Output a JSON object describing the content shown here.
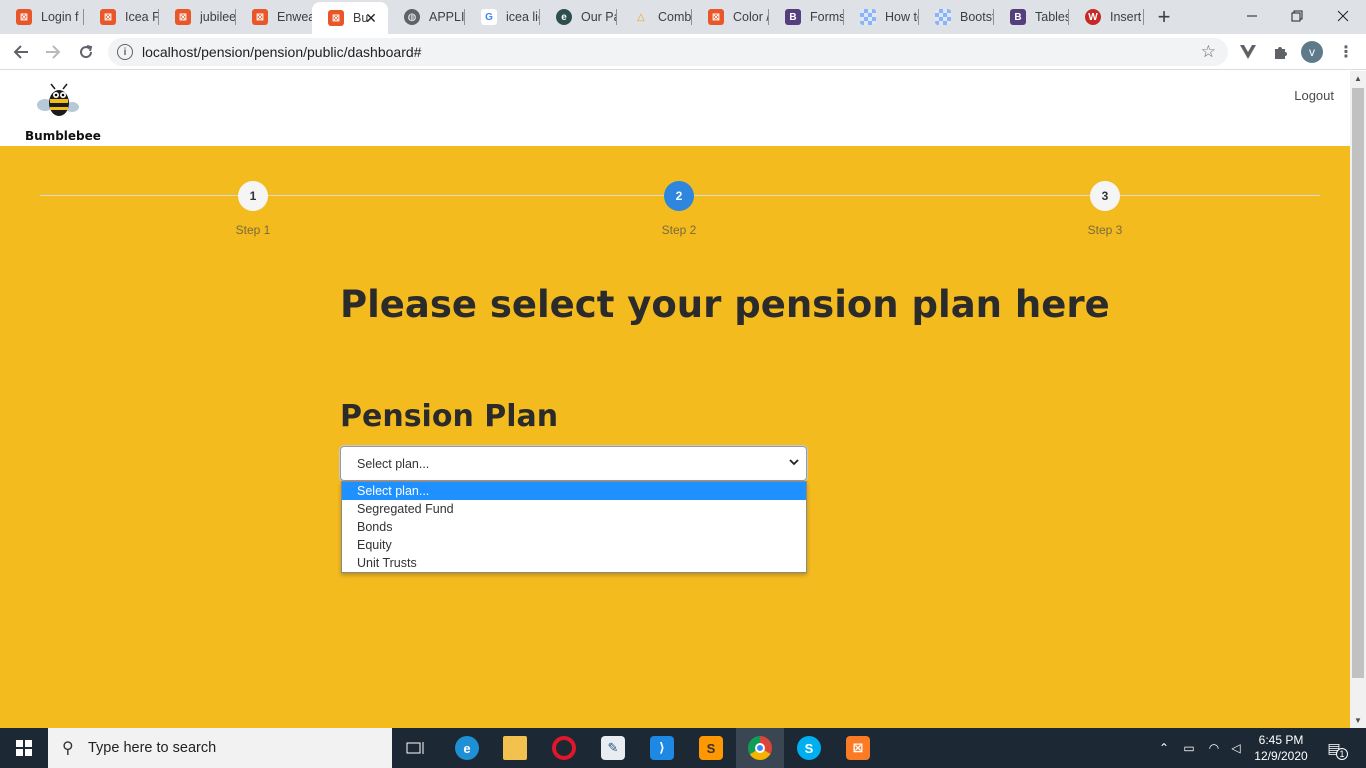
{
  "browser": {
    "tabs": [
      {
        "title": "Login f",
        "icon": "xampp-icon",
        "color": "#e8572a"
      },
      {
        "title": "Icea Fo",
        "icon": "xampp-icon",
        "color": "#e8572a"
      },
      {
        "title": "jubilee",
        "icon": "xampp-icon",
        "color": "#e8572a"
      },
      {
        "title": "Enweal",
        "icon": "xampp-icon",
        "color": "#e8572a"
      },
      {
        "title": "Bu",
        "icon": "xampp-icon",
        "color": "#e8572a",
        "active": true
      },
      {
        "title": "APPLIC",
        "icon": "globe-icon",
        "color": "#5f6368"
      },
      {
        "title": "icea lic",
        "icon": "google-icon",
        "color": "#4285f4"
      },
      {
        "title": "Our Pa",
        "icon": "leaf-icon",
        "color": "#2f4f4f"
      },
      {
        "title": "Combi",
        "icon": "combi-icon",
        "color": "#e6a817"
      },
      {
        "title": "Color /",
        "icon": "xampp-icon",
        "color": "#e8572a"
      },
      {
        "title": "Forms",
        "icon": "bootstrap-icon",
        "color": "#563d7c"
      },
      {
        "title": "How to",
        "icon": "checker-icon",
        "color": "#8ab4f8"
      },
      {
        "title": "Bootst",
        "icon": "checker-icon",
        "color": "#8ab4f8"
      },
      {
        "title": "Tables",
        "icon": "bootstrap-icon",
        "color": "#563d7c"
      },
      {
        "title": "Insert",
        "icon": "w3-icon",
        "color": "#c62828"
      }
    ],
    "url": "localhost/pension/pension/public/dashboard#",
    "profile_initial": "v"
  },
  "site": {
    "brand": "Bumblebee",
    "logout": "Logout",
    "steps": [
      {
        "number": "1",
        "label": "Step 1",
        "active": false
      },
      {
        "number": "2",
        "label": "Step 2",
        "active": true
      },
      {
        "number": "3",
        "label": "Step 3",
        "active": false
      }
    ],
    "heading": "Please select your pension plan here",
    "plan_label": "Pension Plan",
    "plan_select": {
      "value": "Select plan...",
      "options": [
        "Select plan...",
        "Segregated Fund",
        "Bonds",
        "Equity",
        "Unit Trusts"
      ],
      "highlighted": "Select plan..."
    },
    "background_color": "#f4bb1f",
    "accent_color": "#2e86de"
  },
  "taskbar": {
    "search_placeholder": "Type here to search",
    "apps": [
      {
        "name": "task-view",
        "icon": "task-view-icon"
      },
      {
        "name": "edge",
        "icon": "edge-icon"
      },
      {
        "name": "file-explorer",
        "icon": "folder-icon"
      },
      {
        "name": "opera",
        "icon": "opera-icon"
      },
      {
        "name": "notepad",
        "icon": "notepad-icon"
      },
      {
        "name": "vscode",
        "icon": "vscode-icon"
      },
      {
        "name": "sublime",
        "icon": "sublime-icon"
      },
      {
        "name": "chrome",
        "icon": "chrome-icon",
        "running": true
      },
      {
        "name": "skype",
        "icon": "skype-icon"
      },
      {
        "name": "xampp",
        "icon": "xampp-icon"
      }
    ],
    "time": "6:45 PM",
    "date": "12/9/2020",
    "notification_count": "1"
  }
}
